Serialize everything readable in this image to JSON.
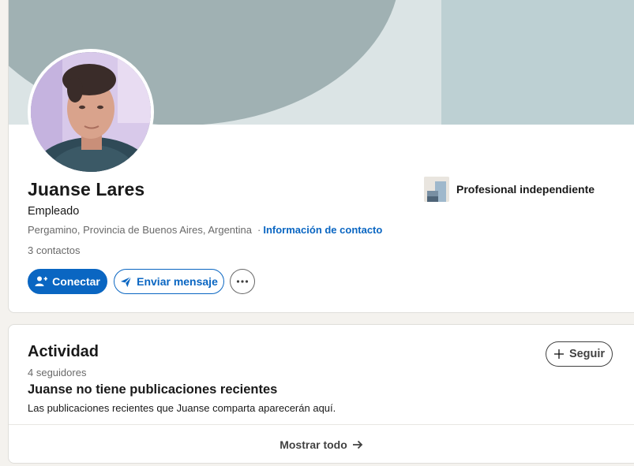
{
  "profile": {
    "name": "Juanse Lares",
    "headline": "Empleado",
    "location": "Pergamino, Provincia de Buenos Aires, Argentina",
    "separator": "·",
    "contact_info_label": "Información de contacto",
    "connections": "3 contactos",
    "company": "Profesional independiente",
    "actions": {
      "connect_label": "Conectar",
      "message_label": "Enviar mensaje",
      "more_label": "···"
    }
  },
  "activity": {
    "title": "Actividad",
    "followers": "4 seguidores",
    "follow_label": "Seguir",
    "empty_heading": "Juanse no tiene publicaciones recientes",
    "empty_desc": "Las publicaciones recientes que Juanse comparta aparecerán aquí.",
    "show_all_label": "Mostrar todo"
  },
  "icons": {
    "connect": "add-person-icon",
    "message": "send-icon",
    "more": "more-icon",
    "follow": "plus-icon",
    "show_all": "arrow-right-icon"
  },
  "colors": {
    "accent": "#0a66c2",
    "page_bg": "#f4f2ee",
    "banner_bg": "#dbe4e5",
    "banner_circle": "#a0b1b3",
    "banner_strip": "#bdd0d3"
  }
}
